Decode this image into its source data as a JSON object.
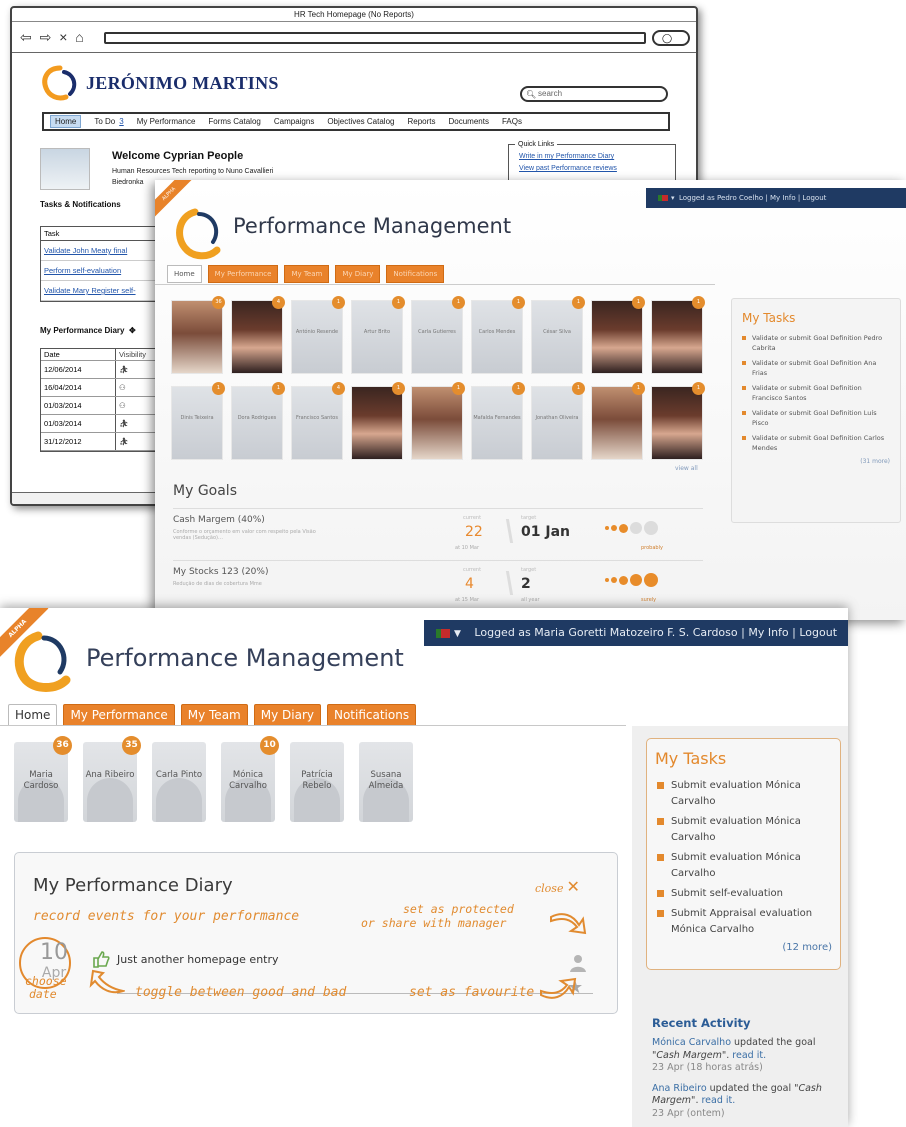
{
  "wireframe": {
    "window_title": "HR Tech Homepage (No Reports)",
    "brand": "JERÓNIMO MARTINS",
    "search_placeholder": "search",
    "menu": [
      "To Do",
      "My Performance",
      "Forms Catalog",
      "Campaigns",
      "Objectives Catalog",
      "Reports",
      "Documents",
      "FAQs"
    ],
    "menu_home": "Home",
    "todo_count": "3",
    "welcome_title": "Welcome Cyprian People",
    "welcome_line1": "Human Resources Tech reporting to Nuno Cavallieri",
    "welcome_line2": "Biedronka",
    "quick_links_title": "Quick Links",
    "quick_links": [
      "Write in my Performance Diary",
      "View past Performance reviews"
    ],
    "tasks_heading": "Tasks & Notifications",
    "task_col": "Task",
    "tasks": [
      "Validate John Meaty final",
      "Perform self-evaluation",
      "Validate Mary Register self-"
    ],
    "diary_heading": "My Performance Diary",
    "diary_cols": [
      "Date",
      "Visibility"
    ],
    "diary_dates": [
      "12/06/2014",
      "16/04/2014",
      "01/03/2014",
      "01/03/2014",
      "31/12/2012"
    ]
  },
  "mid": {
    "ribbon": "ALPHA",
    "logged": "Logged as Pedro Coelho | My Info | Logout",
    "title": "Performance Management",
    "tabs": [
      "Home",
      "My Performance",
      "My Team",
      "My Diary",
      "Notifications"
    ],
    "people": [
      {
        "name": "",
        "badge": "36",
        "photo": "light"
      },
      {
        "name": "",
        "badge": "4",
        "photo": "dark"
      },
      {
        "name": "António Resende",
        "badge": "1",
        "photo": ""
      },
      {
        "name": "Artur Brito",
        "badge": "1",
        "photo": ""
      },
      {
        "name": "Carla Gutierres",
        "badge": "1",
        "photo": ""
      },
      {
        "name": "Carlos Mendes",
        "badge": "1",
        "photo": ""
      },
      {
        "name": "César Silva",
        "badge": "1",
        "photo": ""
      },
      {
        "name": "",
        "badge": "1",
        "photo": "dark"
      },
      {
        "name": "",
        "badge": "1",
        "photo": "dark"
      },
      {
        "name": "Dinis Teixeira",
        "badge": "1",
        "photo": ""
      },
      {
        "name": "Dora Rodrigues",
        "badge": "1",
        "photo": ""
      },
      {
        "name": "Francisco Santos",
        "badge": "4",
        "photo": ""
      },
      {
        "name": "",
        "badge": "1",
        "photo": "dark"
      },
      {
        "name": "",
        "badge": "1",
        "photo": "light"
      },
      {
        "name": "Mafalda Fernandes",
        "badge": "1",
        "photo": ""
      },
      {
        "name": "Jonathan Oliveira",
        "badge": "1",
        "photo": ""
      },
      {
        "name": "",
        "badge": "1",
        "photo": "light"
      },
      {
        "name": "",
        "badge": "1",
        "photo": "dark"
      }
    ],
    "view_all": "view all",
    "goals_heading": "My Goals",
    "goals": [
      {
        "title": "Cash Margem (40%)",
        "desc": "Conforme o orçamento em valor com respeito pela Visão",
        "desc2": "vendas (Sedução)…",
        "current_label": "current",
        "current": "22",
        "current_sub": "at 10 Mar",
        "target_label": "target",
        "target": "01 Jan",
        "target_sub": "",
        "status": "probably"
      },
      {
        "title": "My Stocks 123 (20%)",
        "desc": "Redução de dias de cobertura Mme",
        "desc2": "",
        "current_label": "current",
        "current": "4",
        "current_sub": "at 15 Mar",
        "target_label": "target",
        "target": "2",
        "target_sub": "all year",
        "status": "surely"
      }
    ],
    "tasks_title": "My Tasks",
    "tasks": [
      "Validate or submit Goal Definition Pedro Cabrita",
      "Validate or submit Goal Definition Ana Frias",
      "Validate or submit Goal Definition Francisco Santos",
      "Validate or submit Goal Definition Luís Pisco",
      "Validate or submit Goal Definition Carlos Mendes"
    ],
    "tasks_more": "(31 more)"
  },
  "front": {
    "ribbon": "ALPHA",
    "logged": "Logged as Maria Goretti Matozeiro F. S. Cardoso | My Info | Logout",
    "title": "Performance Management",
    "tabs": [
      "Home",
      "My Performance",
      "My Team",
      "My Diary",
      "Notifications"
    ],
    "people": [
      {
        "name": "Maria Cardoso",
        "badge": "36"
      },
      {
        "name": "Ana Ribeiro",
        "badge": "35"
      },
      {
        "name": "Carla Pinto",
        "badge": ""
      },
      {
        "name": "Mónica Carvalho",
        "badge": "10"
      },
      {
        "name": "Patrícia Rebelo",
        "badge": ""
      },
      {
        "name": "Susana Almeida",
        "badge": ""
      }
    ],
    "diary_title": "My Performance Diary",
    "close_label": "close",
    "ann_record": "record events for your performance",
    "ann_protected_1": "set as protected",
    "ann_protected_2": "or share with manager",
    "date_day": "10",
    "date_month": "Apr",
    "entry": "Just another homepage entry",
    "ann_choose_1": "choose",
    "ann_choose_2": "date",
    "ann_toggle": "toggle between good and bad",
    "ann_favourite": "set as favourite",
    "tasks_title": "My Tasks",
    "tasks": [
      "Submit evaluation Mónica Carvalho",
      "Submit evaluation Mónica Carvalho",
      "Submit evaluation Mónica Carvalho",
      "Submit self-evaluation",
      "Submit Appraisal evaluation Mónica Carvalho"
    ],
    "tasks_more": "(12 more)",
    "recent_title": "Recent Activity",
    "recent": [
      {
        "who": "Mónica Carvalho",
        "text": " updated the goal ",
        "goal": "\"Cash Margem\"",
        "link": "read it.",
        "meta": "23 Apr (18 horas atrás)"
      },
      {
        "who": "Ana Ribeiro",
        "text": " updated the goal ",
        "goal": "\"Cash Margem\"",
        "link": "read it.",
        "meta": "23 Apr (ontem)"
      }
    ]
  },
  "colors": {
    "accent": "#e3892d",
    "topbar": "#1f3a63",
    "link": "#3a6ea5"
  }
}
